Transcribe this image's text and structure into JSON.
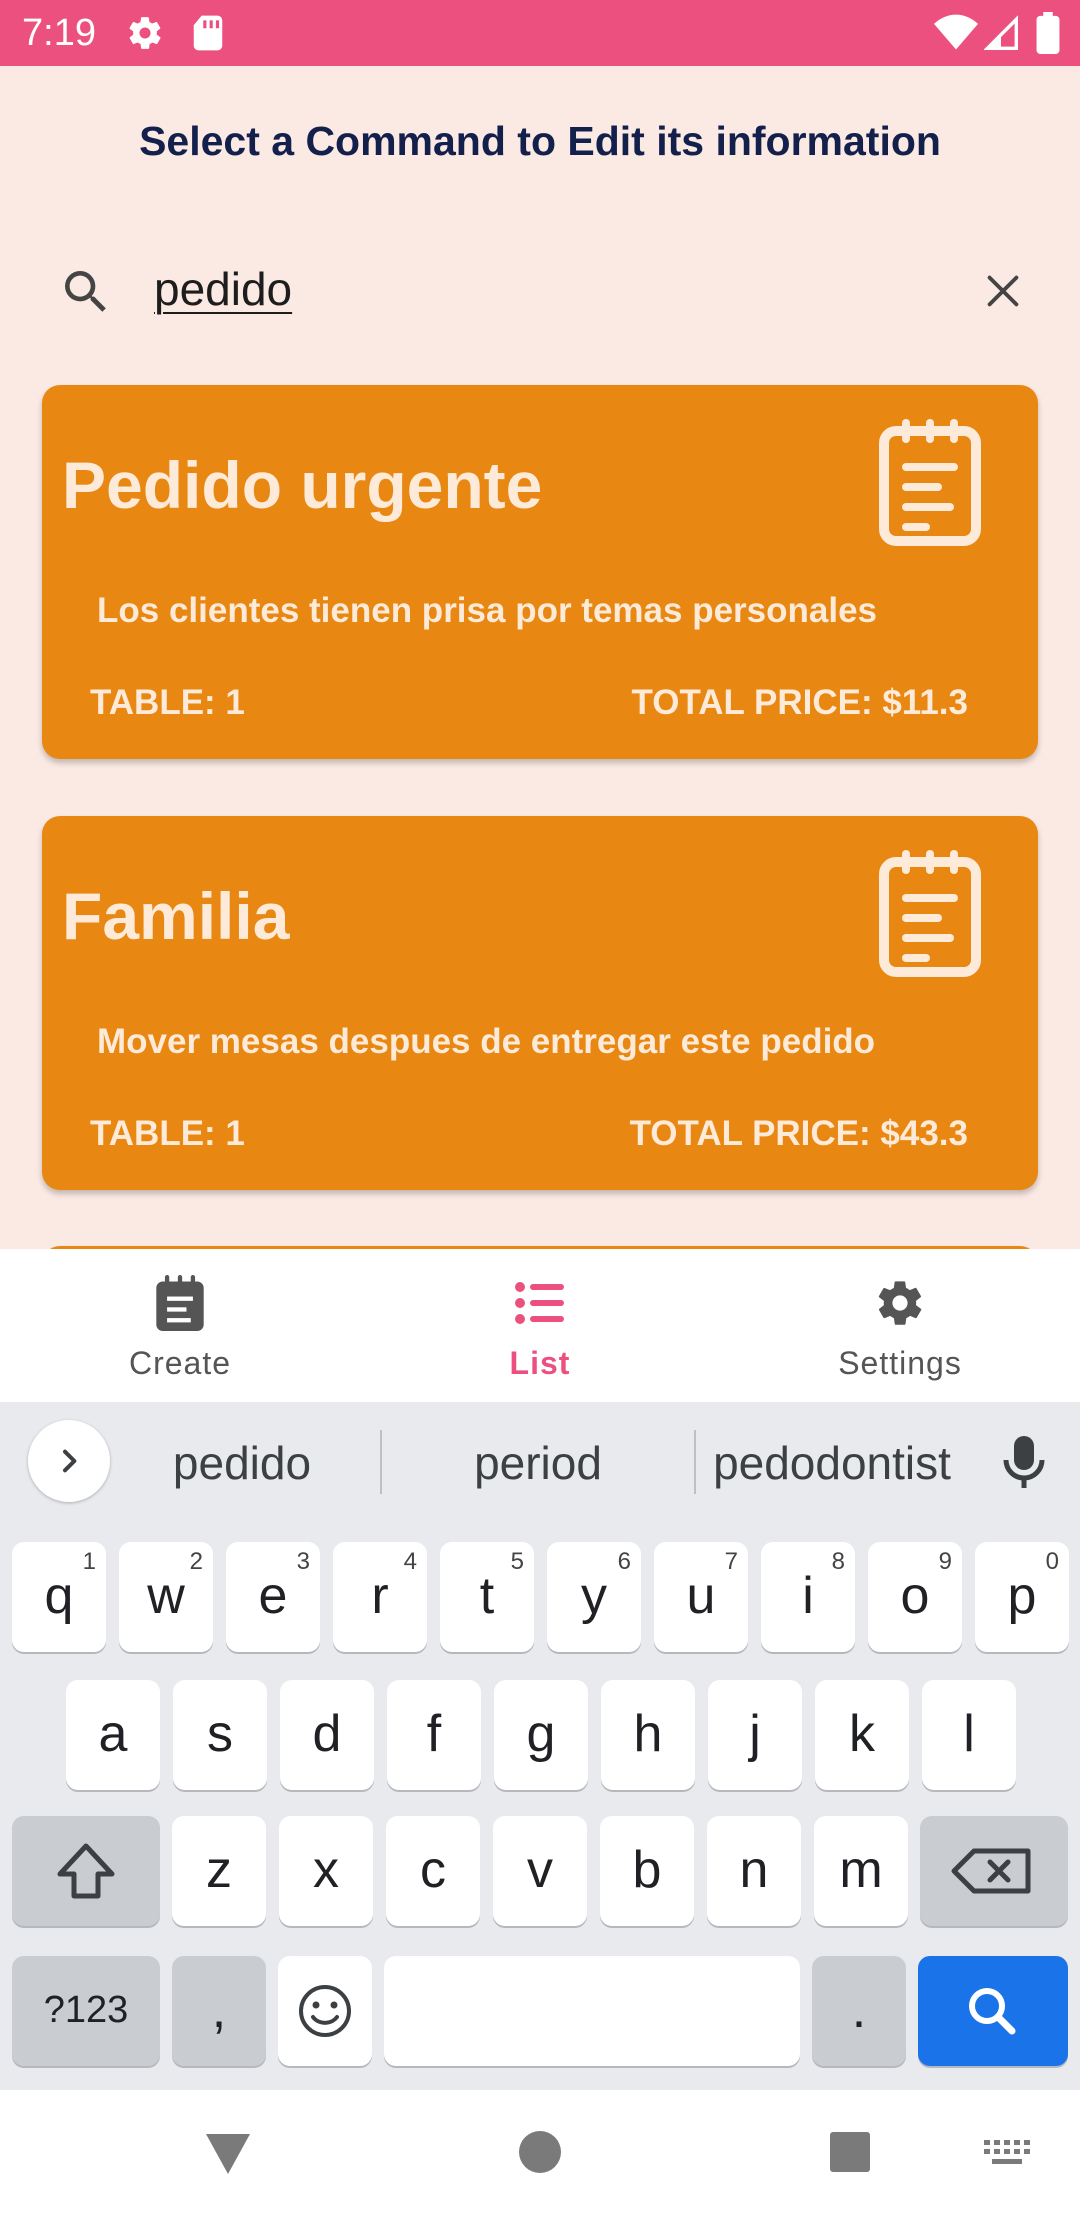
{
  "status_bar": {
    "time": "7:19",
    "bg_color": "#EC507F"
  },
  "header": {
    "title": "Select a Command to Edit its information"
  },
  "search": {
    "value": "pedido",
    "icon": "search-icon",
    "clear_icon": "close-icon"
  },
  "commands": [
    {
      "title": "Pedido urgente",
      "description": "Los clientes tienen prisa por temas personales",
      "table": "TABLE: 1",
      "total_price": "TOTAL PRICE: $11.3"
    },
    {
      "title": "Familia",
      "description": "Mover mesas despues de entregar este pedido",
      "table": "TABLE: 1",
      "total_price": "TOTAL PRICE: $43.3"
    }
  ],
  "card_color": "#E98713",
  "bottom_nav": {
    "items": [
      {
        "label": "Create",
        "icon": "notepad-icon"
      },
      {
        "label": "List",
        "icon": "list-icon",
        "active": true
      },
      {
        "label": "Settings",
        "icon": "gear-icon"
      }
    ],
    "active_color": "#EC507F"
  },
  "keyboard": {
    "suggestions": [
      "pedido",
      "period",
      "pedodontist"
    ],
    "row1": [
      {
        "k": "q",
        "n": "1"
      },
      {
        "k": "w",
        "n": "2"
      },
      {
        "k": "e",
        "n": "3"
      },
      {
        "k": "r",
        "n": "4"
      },
      {
        "k": "t",
        "n": "5"
      },
      {
        "k": "y",
        "n": "6"
      },
      {
        "k": "u",
        "n": "7"
      },
      {
        "k": "i",
        "n": "8"
      },
      {
        "k": "o",
        "n": "9"
      },
      {
        "k": "p",
        "n": "0"
      }
    ],
    "row2": [
      "a",
      "s",
      "d",
      "f",
      "g",
      "h",
      "j",
      "k",
      "l"
    ],
    "row3": [
      "z",
      "x",
      "c",
      "v",
      "b",
      "n",
      "m"
    ],
    "symbols_label": "?123",
    "comma": ",",
    "period": ".",
    "action_color": "#1A73E8"
  }
}
